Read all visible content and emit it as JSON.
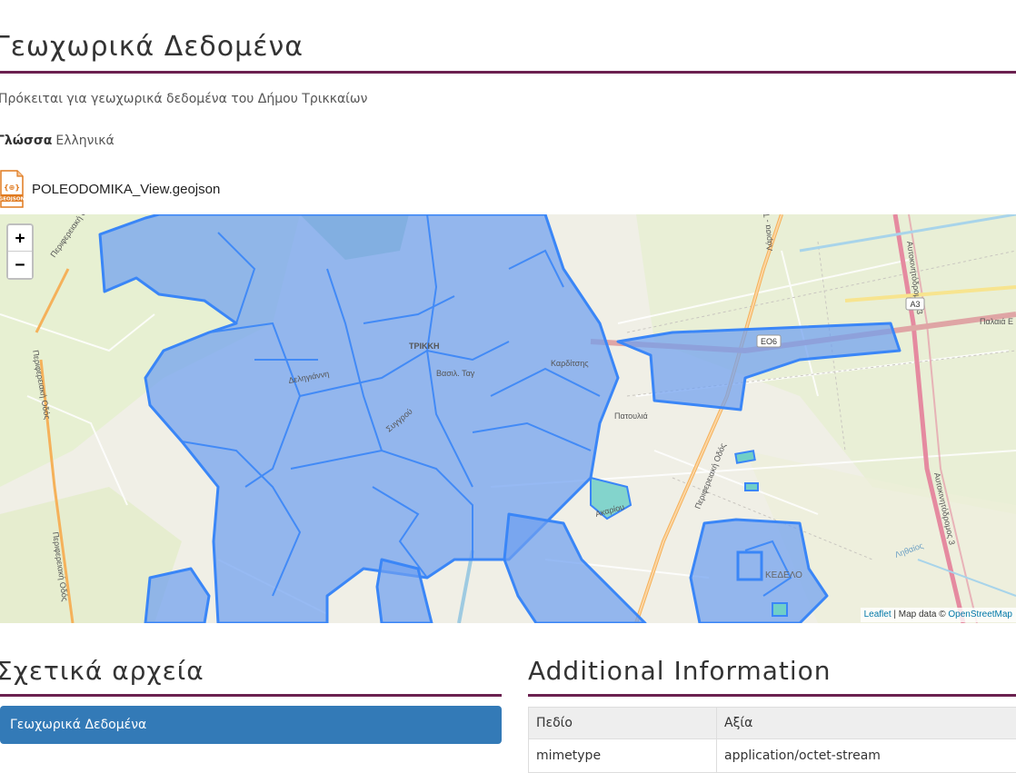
{
  "dataset": {
    "title": "Γεωχωρικά Δεδομένα",
    "description": "Πρόκειται για γεωχωρικά δεδομένα του Δήμου Τρικκαίων",
    "language_label": "Γλώσσα",
    "language_value": "Ελληνικά"
  },
  "resource": {
    "format_icon": "GEOJSON",
    "format_glyph": "{⊕}",
    "file_name": "POLEODOMIKA_View.geojson"
  },
  "map": {
    "zoom_in": "+",
    "zoom_out": "−",
    "attribution_link": "Leaflet",
    "attribution_sep": " | Map data © ",
    "attribution_osm": "OpenStreetMap",
    "colors": {
      "polygon_fill": "#6f9ff0",
      "polygon_stroke": "#3a86f7",
      "secondary": "#70cfc7"
    },
    "labels": {
      "ring_road_1": "Περιφερειακή Οδός",
      "ring_road_2": "Περιφερειακή Οδός",
      "ring_road_3": "Περιφερειακή Οδός",
      "road_lar": "Λάρισα - Τρίκαλα",
      "highway": "Αυτοκινητόδρομος 3",
      "highway_2": "Αυτοκινητόδρομος 3",
      "shield_a3": "A3",
      "shield_eo6": "ΕΟ6",
      "palaia": "Παλαιά Ε",
      "patoulia": "Πατουλιά",
      "kariou": "Καρδίτσης",
      "vasilis": "Βασιλ. Ταγ",
      "syggrou": "Συγγρού",
      "trikkis": "ΤΡΙΚΚΗ",
      "deligianni": "Δεληγιάννη",
      "lithaios": "Ληθαίος",
      "akrariou": "Ακαρίου",
      "kedelo": "ΚΕΔΕΛΟ"
    }
  },
  "related": {
    "heading": "Σχετικά αρχεία",
    "item": "Γεωχωρικά Δεδομένα"
  },
  "additional": {
    "heading": "Additional Information",
    "columns": [
      "Πεδίο",
      "Αξία"
    ],
    "rows": [
      [
        "mimetype",
        "application/octet-stream"
      ]
    ]
  }
}
